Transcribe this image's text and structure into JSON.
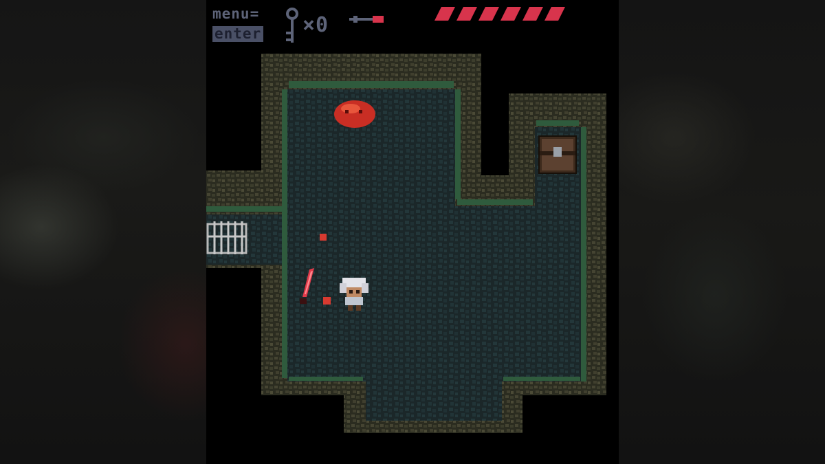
{
  "hud": {
    "menu_label": "menu=",
    "enter_label": "enter",
    "key_count": "×0",
    "health_segments_total": 6,
    "health_segments_filled": 6
  },
  "colors": {
    "health": "#d8344c",
    "hud_text": "#5d6378",
    "floor": "#1c2a2c",
    "wall": "#3a3b2a",
    "moss": "#2e5c3e",
    "slime": "#c92e24",
    "crystal": "#e23a4a"
  },
  "entities": {
    "player": "white-haired-hero",
    "enemy": "red-slime",
    "item": "red-crystal-sword",
    "door": "iron-gate",
    "chest": "wooden-chest"
  }
}
